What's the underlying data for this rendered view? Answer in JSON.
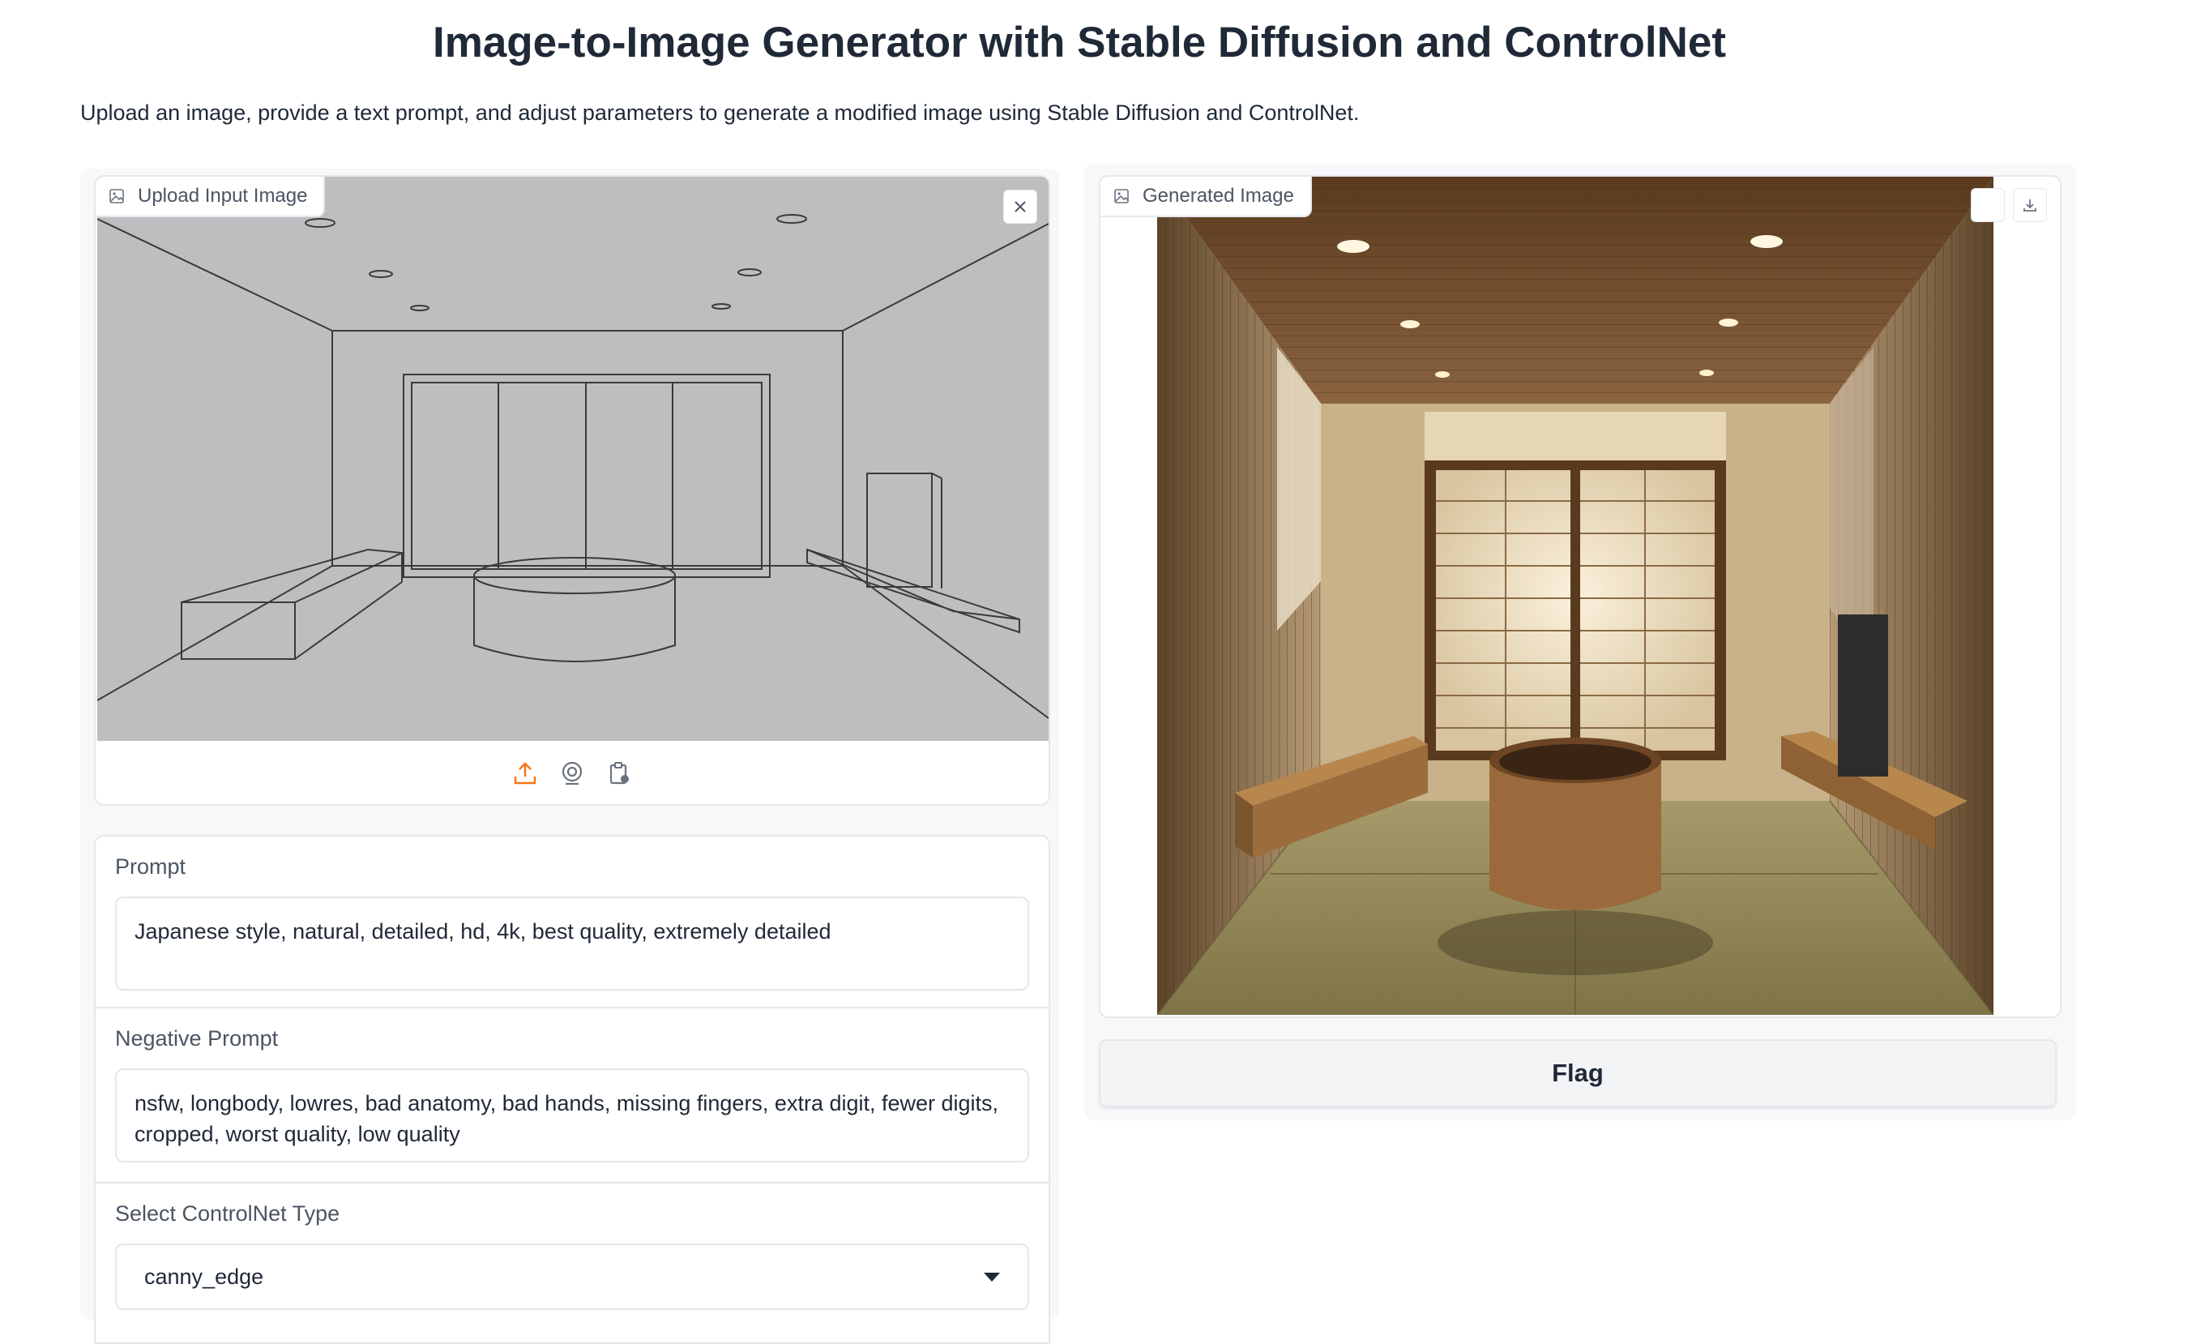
{
  "header": {
    "title": "Image-to-Image Generator with Stable Diffusion and ControlNet",
    "description": "Upload an image, provide a text prompt, and adjust parameters to generate a modified image using Stable Diffusion and ControlNet."
  },
  "input_image": {
    "label": "Upload Input Image",
    "source_icons": [
      "upload-icon",
      "webcam-icon",
      "clipboard-icon"
    ],
    "clear_icon": "close-icon"
  },
  "prompt": {
    "label": "Prompt",
    "value": "Japanese style, natural, detailed, hd, 4k, best quality, extremely detailed"
  },
  "negative_prompt": {
    "label": "Negative Prompt",
    "value": "nsfw, longbody, lowres, bad anatomy, bad hands, missing fingers, extra digit, fewer digits, cropped, worst quality, low quality"
  },
  "controlnet": {
    "label": "Select ControlNet Type",
    "selected": "canny_edge"
  },
  "output_image": {
    "label": "Generated Image",
    "toolbar_icons": [
      "blank-icon",
      "download-icon"
    ]
  },
  "actions": {
    "flag_label": "Flag"
  },
  "colors": {
    "accent": "#f97316",
    "border": "#e5e7eb",
    "sketch_bg": "#bcbec0"
  }
}
